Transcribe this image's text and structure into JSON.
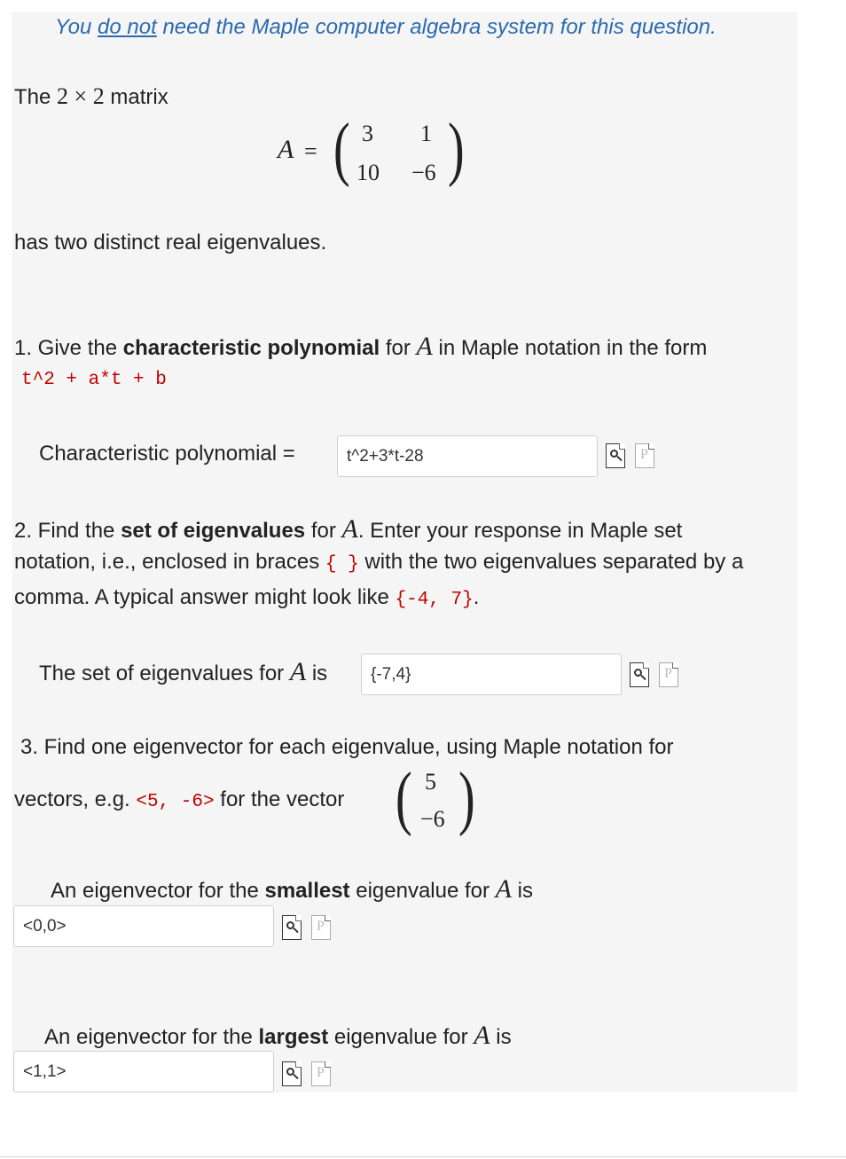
{
  "note": {
    "before": "You ",
    "emph": "do not",
    "after": " need the Maple computer algebra system for this question."
  },
  "intro": {
    "the": "The",
    "dims": "2 × 2",
    "matrix_word": "matrix",
    "matrix_name": "A",
    "equals": "=",
    "matrix": [
      [
        "3",
        "1"
      ],
      [
        "10",
        "−6"
      ]
    ],
    "conclusion": "has two distinct real eigenvalues."
  },
  "q1": {
    "prefix": "1. Give the ",
    "bold": "characteristic polynomial",
    "mid": " for ",
    "var": "A",
    "suffix": " in Maple notation in the form",
    "code": "t^2 + a*t + b",
    "label": "Characteristic polynomial  =",
    "answer": "t^2+3*t-28"
  },
  "q2": {
    "prefix": "2. Find the ",
    "bold": "set of eigenvalues",
    "mid": " for ",
    "var": "A",
    "line1_end": ". Enter your response in Maple set",
    "line2_a": "notation, i.e., enclosed in braces ",
    "braces": "{ }",
    "line2_b": " with the two eigenvalues separated by a",
    "line3_a": "comma. A typical answer might look like ",
    "example": "{-4, 7}",
    "line3_end": ".",
    "label_a": "The set of eigenvalues for ",
    "label_var": "A",
    "label_b": " is",
    "answer": "{-7,4}"
  },
  "q3": {
    "line1": "3. Find one eigenvector for each eigenvalue, using Maple notation for",
    "line2_a": "vectors, e.g. ",
    "example": "<5, -6>",
    "line2_b": " for the vector",
    "vector": [
      "5",
      "−6"
    ],
    "small_a": "An eigenvector for the ",
    "small_bold": "smallest",
    "small_b": " eigenvalue for ",
    "small_var": "A",
    "small_c": " is",
    "small_answer": "<0,0>",
    "large_a": "An eigenvector for the ",
    "large_bold": "largest",
    "large_b": " eigenvalue for ",
    "large_var": "A",
    "large_c": " is",
    "large_answer": "<1,1>"
  },
  "icons": {
    "preview": "preview-icon",
    "maple": "maple-syntax-icon",
    "maple_glyph": "P"
  }
}
